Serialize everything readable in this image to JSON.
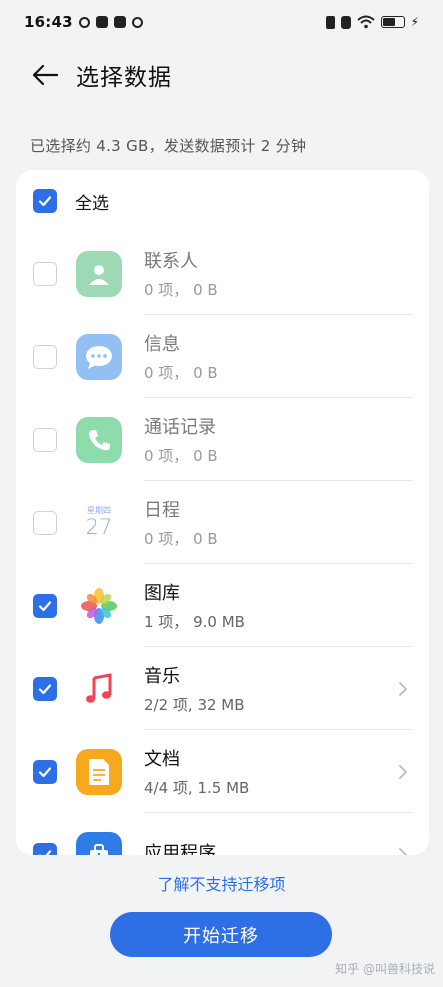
{
  "status_bar": {
    "time": "16:43"
  },
  "header": {
    "title": "选择数据"
  },
  "summary": "已选择约 4.3 GB，发送数据预计 2 分钟",
  "select_all": {
    "label": "全选",
    "checked": true
  },
  "items": [
    {
      "name": "联系人",
      "meta": "0 项， 0 B",
      "checked": false,
      "icon": "contacts-icon"
    },
    {
      "name": "信息",
      "meta": "0 项， 0 B",
      "checked": false,
      "icon": "messages-icon"
    },
    {
      "name": "通话记录",
      "meta": "0 项， 0 B",
      "checked": false,
      "icon": "phone-icon"
    },
    {
      "name": "日程",
      "meta": "0 项， 0 B",
      "checked": false,
      "icon": "calendar-icon",
      "weekday": "星期四",
      "day": "27"
    },
    {
      "name": "图库",
      "meta": "1 项， 9.0 MB",
      "checked": true,
      "icon": "gallery-icon"
    },
    {
      "name": "音乐",
      "meta": "2/2 项, 32 MB",
      "checked": true,
      "icon": "music-icon"
    },
    {
      "name": "文档",
      "meta": "4/4 项, 1.5 MB",
      "checked": true,
      "icon": "document-icon"
    },
    {
      "name": "应用程序",
      "meta": "",
      "checked": true,
      "icon": "apps-icon"
    }
  ],
  "unsupported_link": "了解不支持迁移项",
  "start_button": "开始迁移",
  "watermark": "知乎 @叫兽科技说",
  "colors": {
    "accent": "#2f6fe6",
    "background": "#f1f3f5"
  }
}
